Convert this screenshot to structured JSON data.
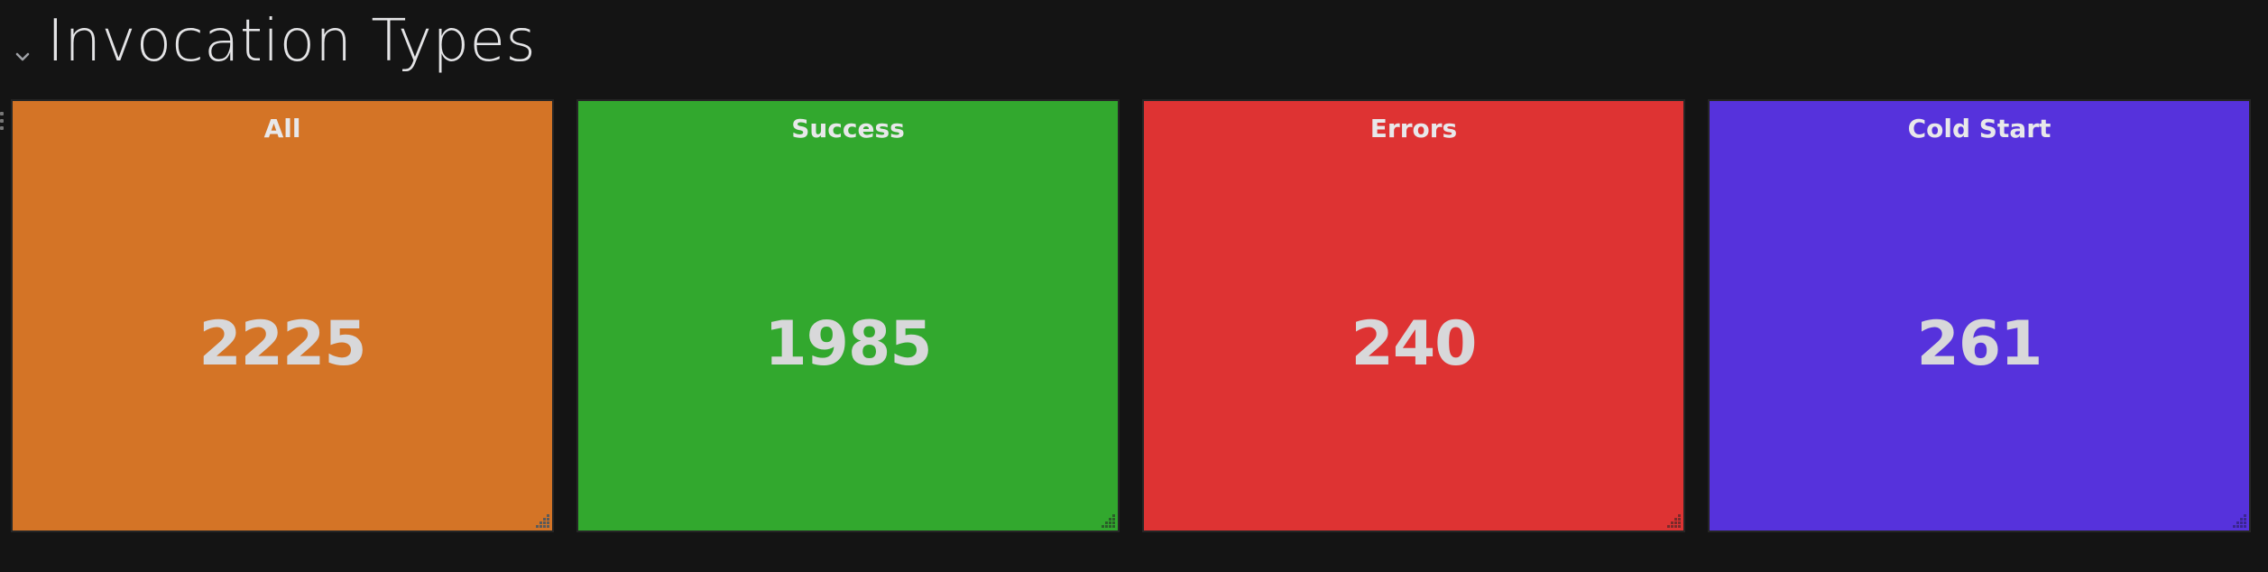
{
  "row": {
    "title": "Invocation Types"
  },
  "panels": [
    {
      "title": "All",
      "value": "2225",
      "color": "#d47426"
    },
    {
      "title": "Success",
      "value": "1985",
      "color": "#32a82e"
    },
    {
      "title": "Errors",
      "value": "240",
      "color": "#de3333"
    },
    {
      "title": "Cold Start",
      "value": "261",
      "color": "#5632dc"
    }
  ],
  "icons": {
    "row_toggle": "chevron-down-icon",
    "resize": "resize-handle-icon",
    "drag": "drag-handle-icon"
  }
}
